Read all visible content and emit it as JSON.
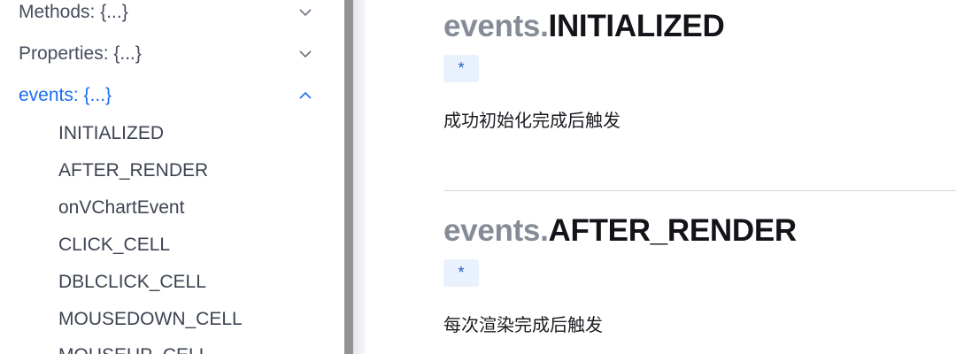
{
  "sidebar": {
    "sections": [
      {
        "label": "Methods: {...}",
        "expanded": false
      },
      {
        "label": "Properties: {...}",
        "expanded": false
      },
      {
        "label": "events: {...}",
        "expanded": true
      }
    ],
    "event_items": [
      {
        "label": "INITIALIZED"
      },
      {
        "label": "AFTER_RENDER"
      },
      {
        "label": "onVChartEvent"
      },
      {
        "label": "CLICK_CELL"
      },
      {
        "label": "DBLCLICK_CELL"
      },
      {
        "label": "MOUSEDOWN_CELL"
      },
      {
        "label": "MOUSEUP_CELL"
      }
    ]
  },
  "main": {
    "events": [
      {
        "prefix": "events.",
        "name": "INITIALIZED",
        "type": "*",
        "description": "成功初始化完成后触发"
      },
      {
        "prefix": "events.",
        "name": "AFTER_RENDER",
        "type": "*",
        "description": "每次渲染完成后触发"
      }
    ]
  },
  "colors": {
    "active_link": "#1a6ef0",
    "title_prefix": "#858c98",
    "badge_bg": "#e9f1fc",
    "badge_text": "#1e5fc8"
  }
}
